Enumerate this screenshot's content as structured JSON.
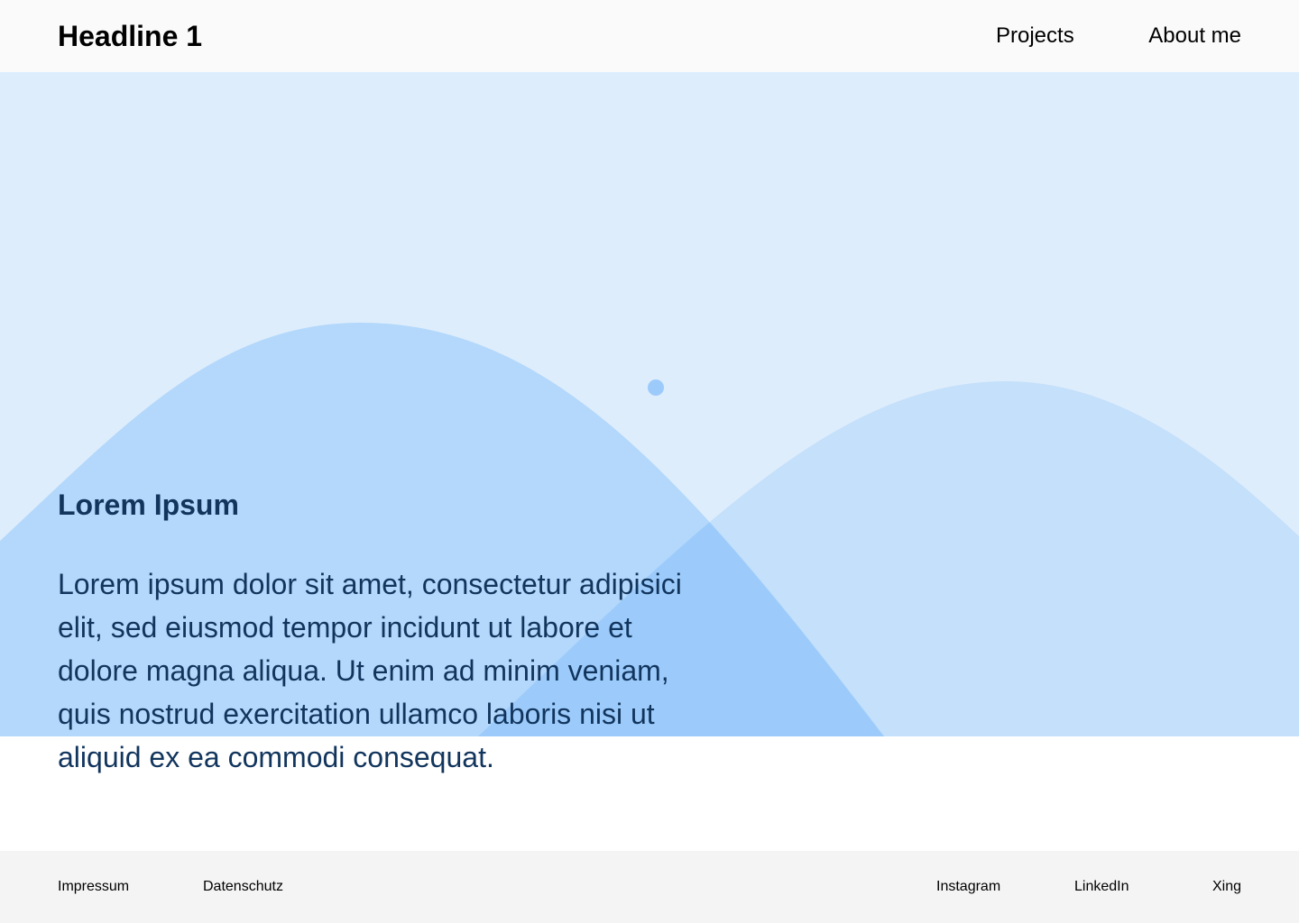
{
  "header": {
    "title": "Headline 1",
    "nav": {
      "projects": "Projects",
      "about": "About me"
    }
  },
  "main": {
    "heading": "Lorem Ipsum",
    "body": "Lorem ipsum dolor sit amet, consectetur adipisici elit, sed eiusmod tempor incidunt ut labore et dolore magna aliqua. Ut enim ad minim veniam, quis nostrud exercitation ullamco laboris nisi ut aliquid ex ea commodi consequat."
  },
  "footer": {
    "left_links": {
      "impressum": "Impressum",
      "datenschutz": "Datenschutz"
    },
    "right_links": {
      "instagram": "Instagram",
      "linkedin": "LinkedIn",
      "xing": "Xing"
    }
  },
  "colors": {
    "header_background": "#fafafa",
    "hero_background": "#deedfc",
    "hero_shape_primary": "#b3d8fb",
    "hero_shape_secondary": "#c4e0fa",
    "hero_shape_overlap": "#9ccbfb",
    "hero_dot": "#9ccbfb",
    "body_text_on_hero": "#12355d",
    "body_text_on_white": "#000000",
    "footer_background": "#f4f4f4"
  }
}
